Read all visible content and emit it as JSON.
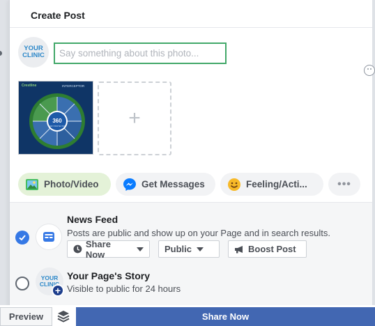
{
  "dialog": {
    "title": "Create Post"
  },
  "composer": {
    "avatar_line1": "YOUR",
    "avatar_line2": "CLINIC",
    "placeholder": "Say something about this photo..."
  },
  "media": {
    "thumbnail": {
      "logo_text": "Crestline",
      "badge_text": "INTERCEPTOR",
      "center_number": "360",
      "center_caption": "BODY PROTECTION"
    },
    "add_tile_label": "+"
  },
  "actions": [
    {
      "label": "Photo/Video",
      "icon": "photo-icon"
    },
    {
      "label": "Get Messages",
      "icon": "messenger-icon"
    },
    {
      "label": "Feeling/Acti...",
      "icon": "smiley-icon"
    },
    {
      "label": "•••",
      "icon": "more-icon"
    }
  ],
  "audience": {
    "news_feed": {
      "title": "News Feed",
      "description": "Posts are public and show up on your Page and in search results.",
      "selected": true,
      "share_now_label": "Share Now",
      "public_label": "Public",
      "boost_label": "Boost Post"
    },
    "story": {
      "title": "Your Page's Story",
      "description": "Visible to public for 24 hours",
      "selected": false,
      "avatar_line1": "YOUR",
      "avatar_line2": "CLINIC"
    }
  },
  "footer": {
    "preview_label": "Preview",
    "share_label": "Share Now"
  },
  "colors": {
    "accent_blue": "#4267b2",
    "check_blue": "#3578e5",
    "composer_border": "#42a869",
    "photo_pill_bg": "#e4f2d8"
  }
}
